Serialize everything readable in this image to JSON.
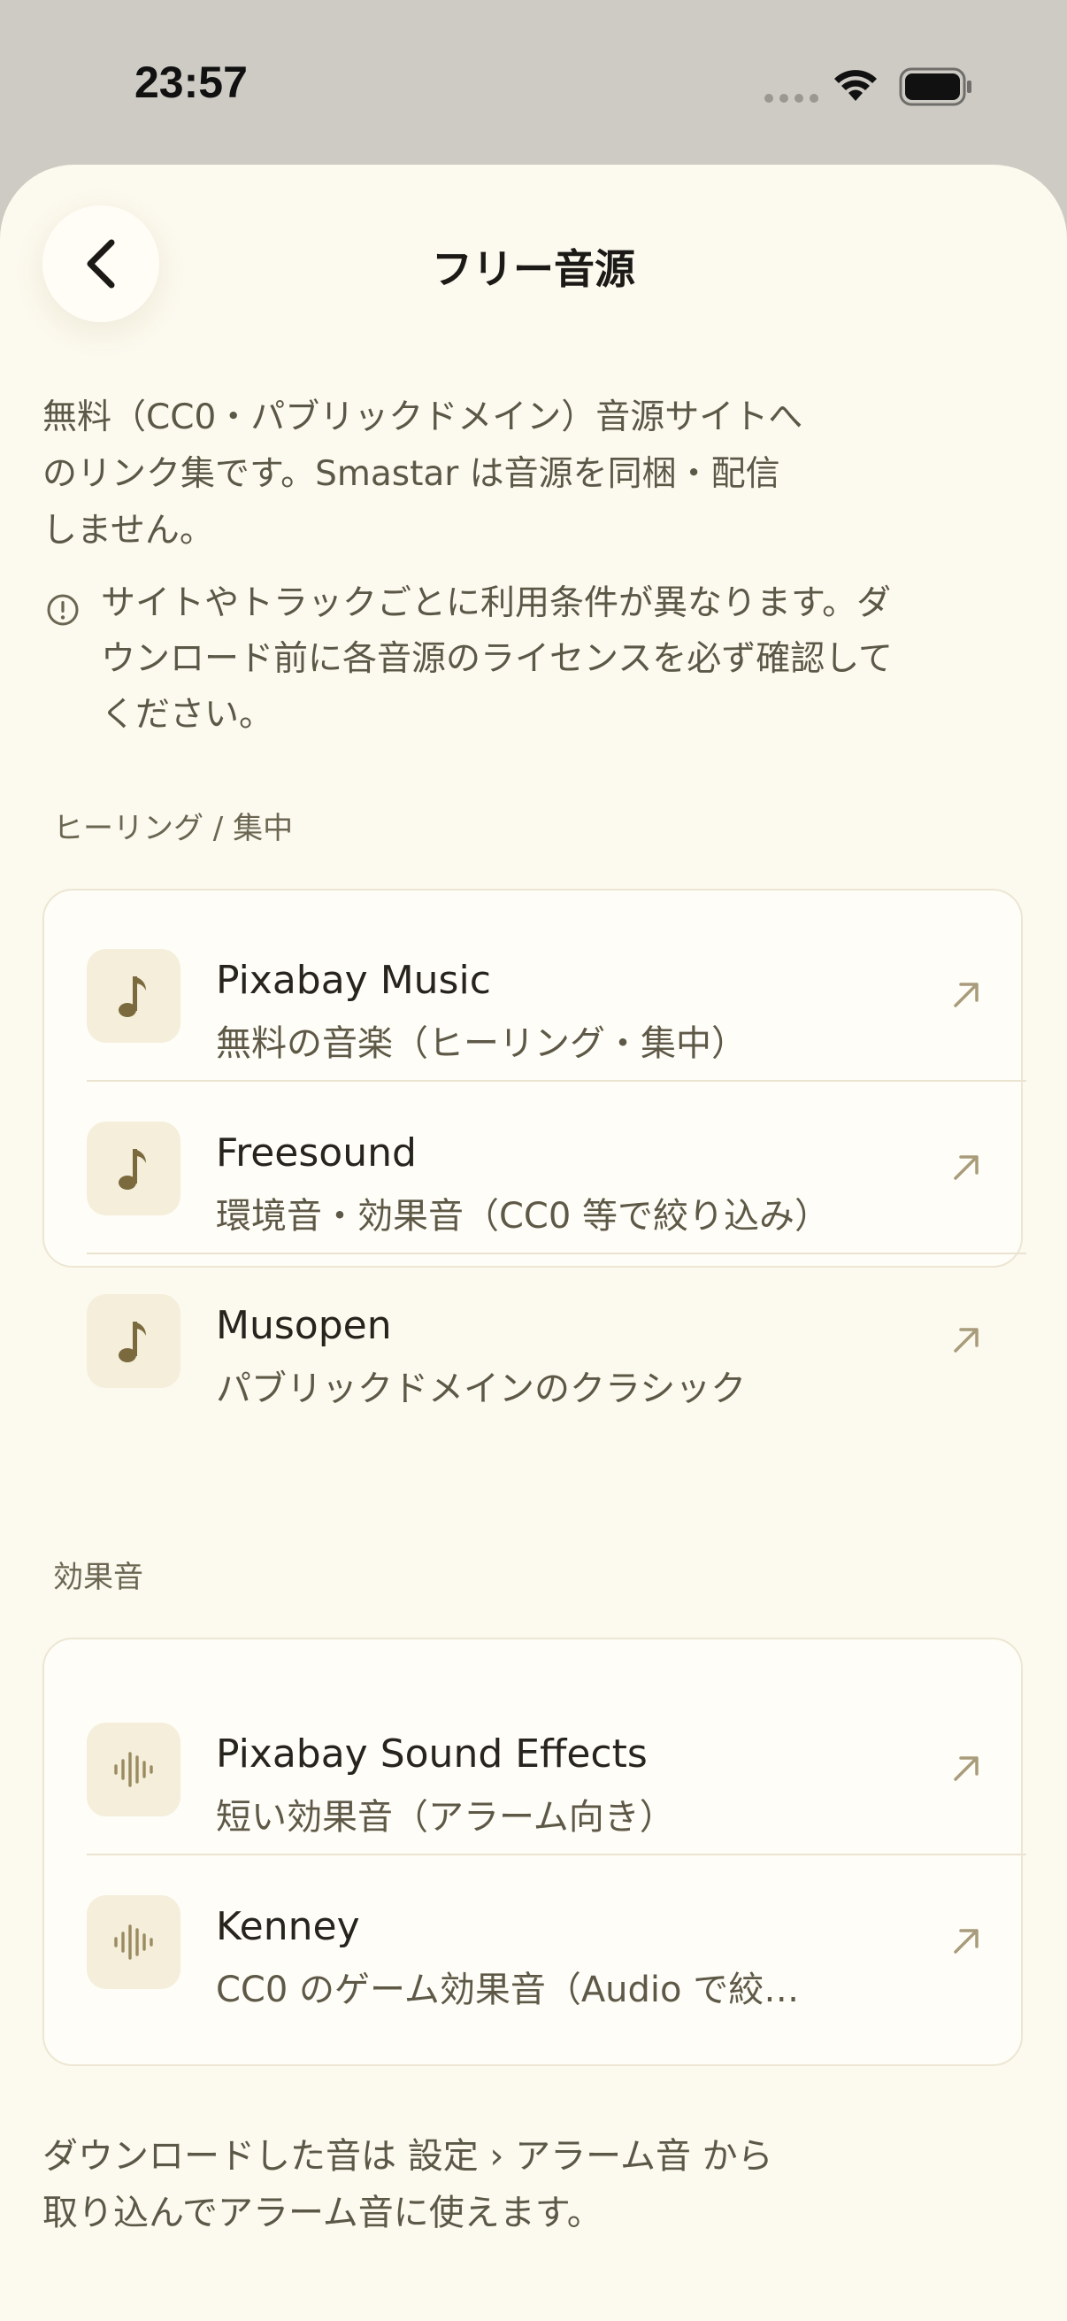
{
  "status_bar": {
    "time": "23:57"
  },
  "header": {
    "title": "フリー音源"
  },
  "intro": {
    "line1": "無料（CC0・パブリックドメイン）音源サイトへ",
    "line2": "のリンク集です。Smastar は音源を同梱・配信",
    "line3": "しません。"
  },
  "notice": {
    "line1": "サイトやトラックごとに利用条件が異なります。ダ",
    "line2": "ウンロード前に各音源のライセンスを必ず確認して",
    "line3": "ください。"
  },
  "sections": [
    {
      "label": "ヒーリング / 集中",
      "items": [
        {
          "title": "Pixabay Music",
          "subtitle": "無料の音楽（ヒーリング・集中）",
          "icon": "music-note-icon"
        },
        {
          "title": "Freesound",
          "subtitle": "環境音・効果音（CC0 等で絞り込み）",
          "icon": "music-note-icon"
        },
        {
          "title": "Musopen",
          "subtitle": "パブリックドメインのクラシック",
          "icon": "music-note-icon"
        }
      ]
    },
    {
      "label": "効果音",
      "items": [
        {
          "title": "Pixabay Sound Effects",
          "subtitle": "短い効果音（アラーム向き）",
          "icon": "waveform-icon"
        },
        {
          "title": "Kenney",
          "subtitle": "CC0 のゲーム効果音（Audio で絞…",
          "icon": "waveform-icon"
        }
      ]
    }
  ],
  "footer": {
    "line1": "ダウンロードした音は 設定 › アラーム音 から",
    "line2": "取り込んでアラーム音に使えます。"
  },
  "colors": {
    "background": "#cdcbc3",
    "sheet": "#fcf9ee",
    "card": "#fffdf7",
    "icon_tile": "#f4eedb",
    "accent_brown": "#7a6a3e",
    "text_primary": "#26241d",
    "text_secondary": "#5e5947"
  }
}
